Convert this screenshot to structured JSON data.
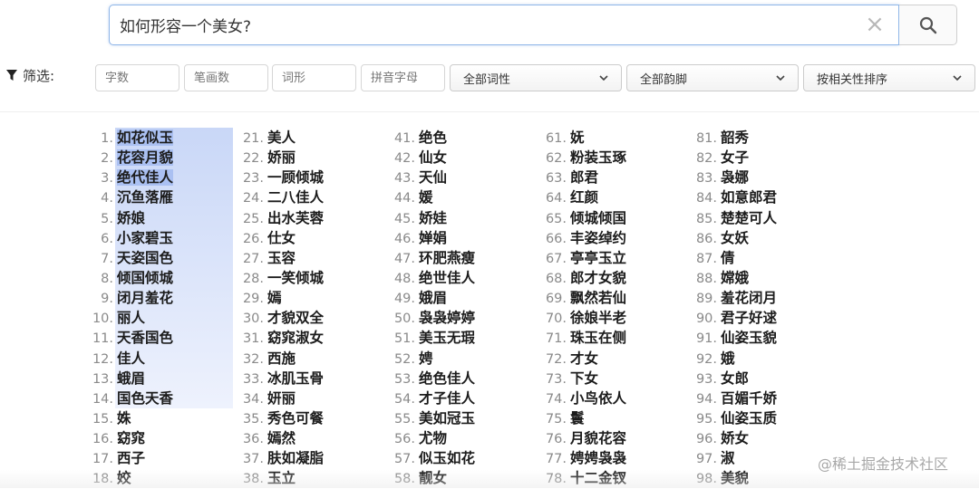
{
  "search": {
    "value": "如何形容一个美女?",
    "clear_symbol": "×"
  },
  "filters": {
    "label": "筛选:",
    "zishu_placeholder": "字数",
    "bihua_placeholder": "笔画数",
    "cixing_placeholder": "词形",
    "pinyin_placeholder": "拼音字母",
    "pos_select": "全部词性",
    "rhyme_select": "全部韵脚",
    "sort_select": "按相关性排序"
  },
  "results": [
    [
      "如花似玉",
      "花容月貌",
      "绝代佳人",
      "沉鱼落雁",
      "娇娘",
      "小家碧玉",
      "天姿国色",
      "倾国倾城",
      "闭月羞花",
      "丽人",
      "天香国色",
      "佳人",
      "蛾眉",
      "国色天香",
      "姝",
      "窈窕",
      "西子",
      "姣"
    ],
    [
      "美人",
      "娇丽",
      "一顾倾城",
      "二八佳人",
      "出水芙蓉",
      "仕女",
      "玉容",
      "一笑倾城",
      "嫣",
      "才貌双全",
      "窈窕淑女",
      "西施",
      "冰肌玉骨",
      "妍丽",
      "秀色可餐",
      "嫣然",
      "肤如凝脂",
      "玉立"
    ],
    [
      "绝色",
      "仙女",
      "天仙",
      "媛",
      "娇娃",
      "婵娟",
      "环肥燕瘦",
      "绝世佳人",
      "娥眉",
      "袅袅婷婷",
      "美玉无瑕",
      "娉",
      "绝色佳人",
      "才子佳人",
      "美如冠玉",
      "尤物",
      "似玉如花",
      "靓女"
    ],
    [
      "妩",
      "粉装玉琢",
      "郎君",
      "红颜",
      "倾城倾国",
      "丰姿绰约",
      "亭亭玉立",
      "郎才女貌",
      "飘然若仙",
      "徐娘半老",
      "珠玉在侧",
      "才女",
      "下女",
      "小鸟依人",
      "鬟",
      "月貌花容",
      "娉娉袅袅",
      "十二金钗"
    ],
    [
      "韶秀",
      "女子",
      "袅娜",
      "如意郎君",
      "楚楚可人",
      "女妖",
      "倩",
      "嫦娥",
      "羞花闭月",
      "君子好逑",
      "仙姿玉貌",
      "娥",
      "女郎",
      "百媚千娇",
      "仙姿玉质",
      "娇女",
      "淑",
      "美貌"
    ]
  ],
  "watermark": "@稀土掘金技术社区",
  "colors": {
    "accent_border": "#8fb6e8",
    "highlight": "#aac0f2"
  }
}
